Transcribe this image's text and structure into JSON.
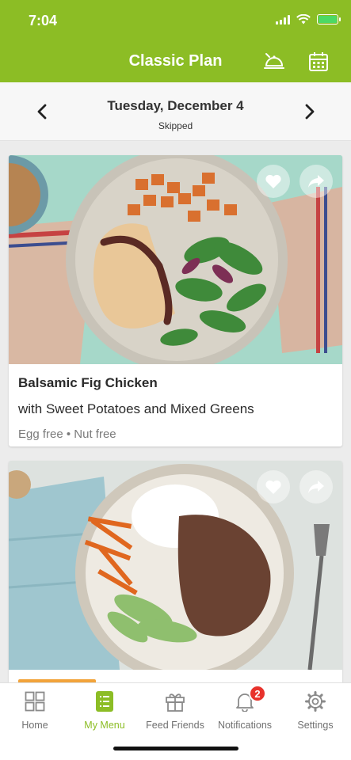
{
  "status_bar": {
    "time": "7:04"
  },
  "header": {
    "title": "Classic Plan",
    "icons": [
      "dish-icon",
      "calendar-icon"
    ]
  },
  "date_nav": {
    "date": "Tuesday, December 4",
    "status": "Skipped"
  },
  "recipes": [
    {
      "title": "Balsamic Fig Chicken",
      "subtitle": "with Sweet Potatoes and Mixed Greens",
      "tags": "Egg free • Nut free"
    },
    {
      "title": "",
      "subtitle": "",
      "tags": ""
    }
  ],
  "tabs": [
    {
      "label": "Home",
      "icon": "grid-icon"
    },
    {
      "label": "My Menu",
      "icon": "menu-list-icon",
      "active": true
    },
    {
      "label": "Feed Friends",
      "icon": "gift-icon"
    },
    {
      "label": "Notifications",
      "icon": "bell-icon",
      "badge": "2"
    },
    {
      "label": "Settings",
      "icon": "gear-icon"
    }
  ],
  "colors": {
    "brand": "#8cbd25",
    "badge": "#e8322c"
  }
}
